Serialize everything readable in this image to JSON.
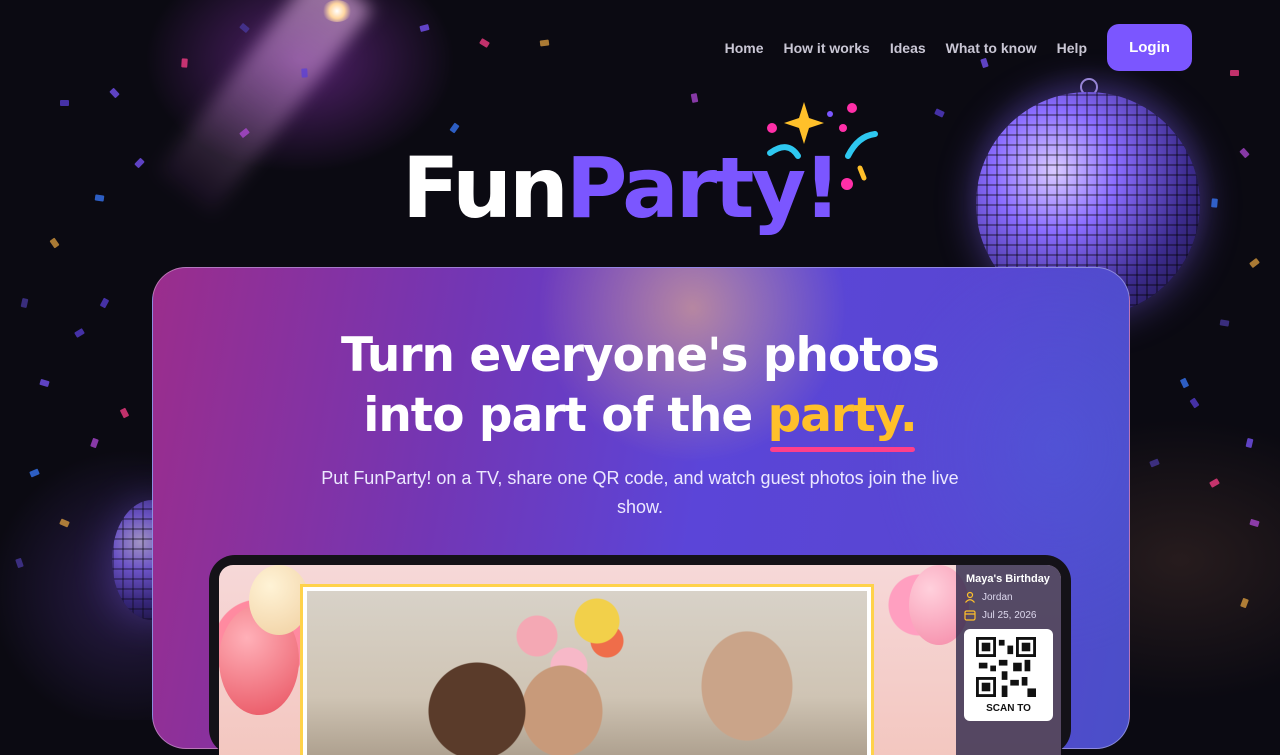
{
  "nav": {
    "items": [
      {
        "label": "Home"
      },
      {
        "label": "How it works"
      },
      {
        "label": "Ideas"
      },
      {
        "label": "What to know"
      },
      {
        "label": "Help"
      }
    ],
    "login_label": "Login"
  },
  "brand": {
    "part1": "Fun",
    "part2": "Party!",
    "colors": {
      "primary": "#7b56ff",
      "accent_yellow": "#ffc02a",
      "accent_pink": "#ff3f8a",
      "accent_cyan": "#2ec8f0"
    }
  },
  "hero": {
    "headline_line1": "Turn everyone's photos",
    "headline_line2_prefix": "into part of the ",
    "headline_highlight": "party.",
    "subtitle": "Put FunParty! on a TV, share one QR code, and watch guest photos join the live show."
  },
  "preview": {
    "event_title": "Maya's Birthday",
    "host_name": "Jordan",
    "event_date": "Jul 25, 2026",
    "qr_caption": "SCAN TO",
    "icons": {
      "host": "user-icon",
      "date": "calendar-icon"
    }
  }
}
